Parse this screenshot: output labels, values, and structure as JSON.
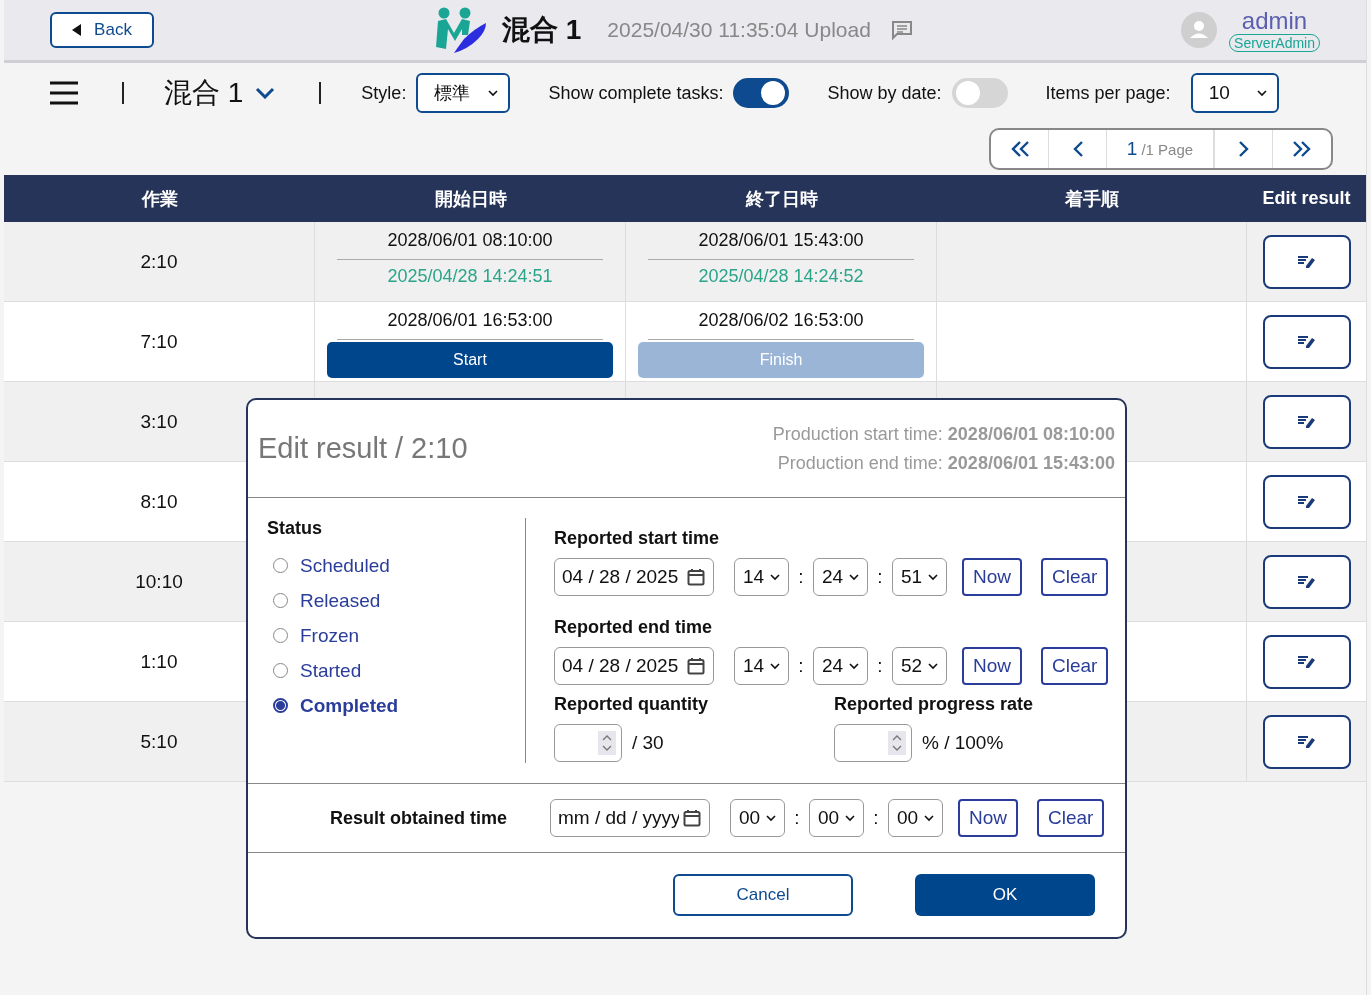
{
  "header": {
    "back_button": "Back",
    "title": "混合 1",
    "upload_info": "2025/04/30 11:35:04 Upload",
    "user": {
      "name": "admin",
      "role": "ServerAdmin"
    }
  },
  "toolbar": {
    "selector": "混合 1",
    "style_label": "Style:",
    "style_value": "標準",
    "toggles": [
      {
        "label": "Show complete tasks:",
        "on": true
      },
      {
        "label": "Show by date:",
        "on": false
      }
    ],
    "items_label": "Items per page:",
    "items_value": "10"
  },
  "pagination": {
    "page": "1",
    "total": "/1 Page"
  },
  "table": {
    "columns": [
      "作業",
      "開始日時",
      "終了日時",
      "着手順",
      "Edit result"
    ],
    "rows": [
      {
        "kind": "reported",
        "task": "2:10",
        "start": "2028/06/01 08:10:00",
        "end": "2028/06/01 15:43:00",
        "actual_start": "2025/04/28 14:24:51",
        "actual_end": "2025/04/28 14:24:52"
      },
      {
        "kind": "scheduled",
        "task": "7:10",
        "start": "2028/06/01 16:53:00",
        "end": "2028/06/02 16:53:00",
        "start_button": {
          "label": "Start",
          "disabled": false
        },
        "finish_button": {
          "label": "Finish",
          "disabled": true
        }
      },
      {
        "kind": "covered",
        "task": "3:10"
      },
      {
        "kind": "covered",
        "task": "8:10"
      },
      {
        "kind": "covered",
        "task": "10:10"
      },
      {
        "kind": "covered",
        "task": "1:10"
      },
      {
        "kind": "covered",
        "task": "5:10"
      }
    ]
  },
  "modal": {
    "title": "Edit result / 2:10",
    "production": [
      "Production start time: **2028/06/01 08:10:00**",
      "Production end time: **2028/06/01 15:43:00**"
    ],
    "status_label": "Status",
    "statuses": [
      {
        "label": "Scheduled",
        "selected": false
      },
      {
        "label": "Released",
        "selected": false
      },
      {
        "label": "Frozen",
        "selected": false
      },
      {
        "label": "Started",
        "selected": false
      },
      {
        "label": "Completed",
        "selected": true
      }
    ],
    "times": [
      {
        "label": "Reported start time",
        "date": "04 / 28 / 2025",
        "hour": "14",
        "minute": "24",
        "second": "51",
        "now": "Now",
        "clear": "Clear"
      },
      {
        "label": "Reported end time",
        "date": "04 / 28 / 2025",
        "hour": "14",
        "minute": "24",
        "second": "52",
        "now": "Now",
        "clear": "Clear"
      }
    ],
    "quantity": {
      "label": "Reported quantity",
      "suffix": "/ 30"
    },
    "progress": {
      "label": "Reported progress rate",
      "suffix": "% / 100%"
    },
    "result_time": {
      "label": "Result obtained time",
      "placeholder": "mm / dd / yyyy",
      "hour": "00",
      "minute": "00",
      "second": "00",
      "now": "Now",
      "clear": "Clear"
    },
    "separator": ":",
    "cancel": "Cancel",
    "ok": "OK"
  }
}
